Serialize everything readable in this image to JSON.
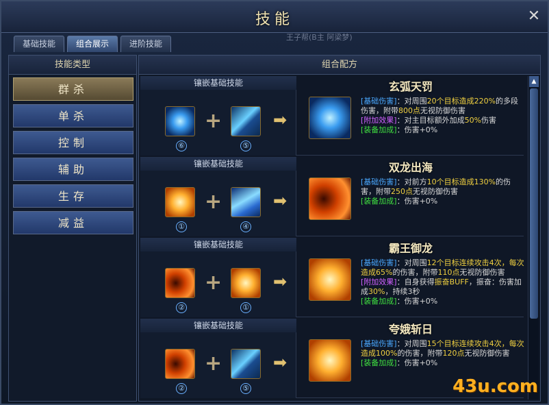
{
  "window": {
    "title": "技能",
    "subtitle": "王子帮(B主 阿梁梦)"
  },
  "tabs": [
    {
      "label": "基础技能"
    },
    {
      "label": "组合展示"
    },
    {
      "label": "进阶技能"
    }
  ],
  "left_panel": {
    "heading": "技能类型",
    "categories": [
      {
        "label": "群杀"
      },
      {
        "label": "单杀"
      },
      {
        "label": "控制"
      },
      {
        "label": "辅助"
      },
      {
        "label": "生存"
      },
      {
        "label": "减益"
      }
    ]
  },
  "right_panel": {
    "heading": "组合配方",
    "recipe_label": "镶嵌基础技能",
    "recipes": [
      {
        "name": "玄弧天罚",
        "inputs": [
          {
            "icon": "blue-orb-icon",
            "num": "⑥"
          },
          {
            "icon": "feather-icon",
            "num": "⑤"
          }
        ],
        "result_icon": "blue-orb-icon",
        "lines": [
          {
            "tag": "[基础伤害]",
            "text": "：对周围",
            "hl1": "20个目标造成220%",
            "rest": "的多段伤害，附带",
            "hl2": "800点",
            "end": "无视防御伤害"
          },
          {
            "tag": "[附加效果]",
            "text": "：对主目标额外加成",
            "hl1": "50%",
            "rest": "伤害"
          },
          {
            "tag": "[装备加成]",
            "text": "：伤害+0%"
          }
        ]
      },
      {
        "name": "双龙出海",
        "inputs": [
          {
            "icon": "golden-swirl-icon",
            "num": "①"
          },
          {
            "icon": "ice-shard-icon",
            "num": "④"
          }
        ],
        "result_icon": "fire-swirl-icon",
        "lines": [
          {
            "tag": "[基础伤害]",
            "text": "：对前方",
            "hl1": "10个目标造成130%",
            "rest": "的伤害，附带",
            "hl2": "250点",
            "end": "无视防御伤害"
          },
          {
            "tag": "[装备加成]",
            "text": "：伤害+0%"
          }
        ]
      },
      {
        "name": "霸王御龙",
        "inputs": [
          {
            "icon": "fire-tunnel-icon",
            "num": "②"
          },
          {
            "icon": "golden-swirl-icon",
            "num": "①"
          }
        ],
        "result_icon": "golden-swirl-icon",
        "lines": [
          {
            "tag": "[基础伤害]",
            "text": "：对周围",
            "hl1": "12个目标连续攻击4次，每次造成65%",
            "rest": "的伤害，附带",
            "hl2": "110点",
            "end": "无视防御伤害"
          },
          {
            "tag": "[附加效果]",
            "text": "：自身获得",
            "hl1": "振奋BUFF",
            "rest": "，振奋：伤害加成",
            "hl2": "30%",
            "end": "，持续3秒"
          },
          {
            "tag": "[装备加成]",
            "text": "：伤害+0%"
          }
        ]
      },
      {
        "name": "夸娥斩日",
        "inputs": [
          {
            "icon": "fire-tunnel-icon",
            "num": "②"
          },
          {
            "icon": "feather-icon",
            "num": "⑤"
          }
        ],
        "result_icon": "golden-swirl-icon",
        "lines": [
          {
            "tag": "[基础伤害]",
            "text": "：对周围",
            "hl1": "15个目标连续攻击4次，每次造成100%",
            "rest": "的伤害，附带",
            "hl2": "120点",
            "end": "无视防御伤害"
          },
          {
            "tag": "[装备加成]",
            "text": "：伤害+0%"
          }
        ]
      }
    ]
  },
  "watermark": "43u.com",
  "colors": {
    "accent": "#f0e2b0",
    "tag_blue": "#4aa8ff",
    "tag_purple": "#d060ff",
    "tag_green": "#40e040",
    "highlight": "#f0d040"
  }
}
